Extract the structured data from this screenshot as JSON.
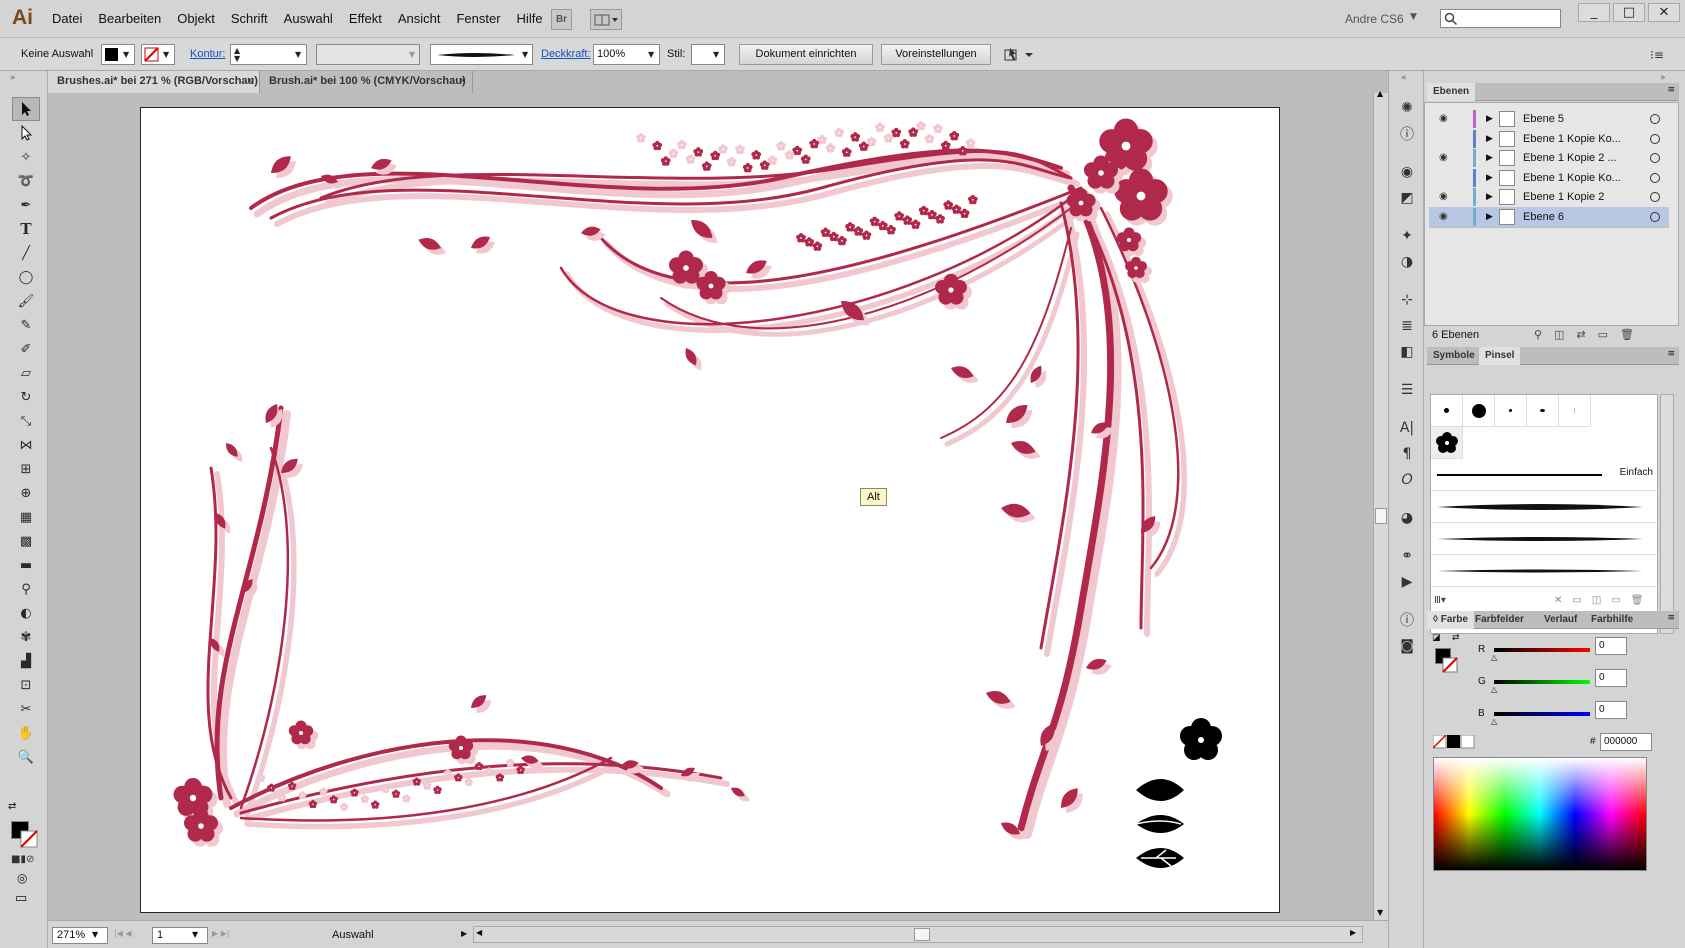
{
  "app": {
    "logo": "Ai",
    "menus": [
      "Datei",
      "Bearbeiten",
      "Objekt",
      "Schrift",
      "Auswahl",
      "Effekt",
      "Ansicht",
      "Fenster",
      "Hilfe"
    ],
    "bridge_label": "Br",
    "user": "Andre CS6",
    "window_buttons": [
      "_",
      "□",
      "✕"
    ]
  },
  "control_bar": {
    "selection": "Keine Auswahl",
    "stroke_label": "Kontur:",
    "opacity_label": "Deckkraft:",
    "opacity_value": "100%",
    "style_label": "Stil:",
    "doc_setup_button": "Dokument einrichten",
    "prefs_button": "Voreinstellungen"
  },
  "tabs": [
    {
      "label": "Brushes.ai* bei 271 % (RGB/Vorschau)",
      "close": "×"
    },
    {
      "label": "Brush.ai* bei 100 % (CMYK/Vorschau)",
      "close": "×"
    }
  ],
  "canvas": {
    "tooltip": "Alt",
    "art_color": "#b0294a",
    "art_light_color": "#f2c8d0"
  },
  "status": {
    "zoom": "271%",
    "page": "1",
    "tool": "Auswahl"
  },
  "layers_panel": {
    "title": "Ebenen",
    "layers": [
      {
        "name": "Ebene 5",
        "visible": true,
        "color": "#c65fd0"
      },
      {
        "name": "Ebene 1 Kopie Ko...",
        "visible": false,
        "color": "#5f7fd0"
      },
      {
        "name": "Ebene 1 Kopie 2 ...",
        "visible": true,
        "color": "#6fb0d0"
      },
      {
        "name": "Ebene 1 Kopie Ko...",
        "visible": false,
        "color": "#5f7fd0"
      },
      {
        "name": "Ebene 1 Kopie 2",
        "visible": true,
        "color": "#6fb0d0"
      },
      {
        "name": "Ebene 6",
        "visible": true,
        "color": "#6fb0d0",
        "selected": true
      }
    ],
    "footer": "6 Ebenen"
  },
  "brushes_panel": {
    "tabs": [
      "Symbole",
      "Pinsel"
    ],
    "active_tab": "Pinsel",
    "basic_brush": "Einfach"
  },
  "color_panel": {
    "tabs": [
      "Farbe",
      "Farbfelder",
      "Verlauf",
      "Farbhilfe"
    ],
    "channels": [
      {
        "label": "R",
        "value": "0",
        "color": "#d02020"
      },
      {
        "label": "G",
        "value": "0",
        "color": "#20b020"
      },
      {
        "label": "B",
        "value": "0",
        "color": "#2040d0"
      }
    ],
    "hex_label": "#",
    "hex": "000000"
  }
}
